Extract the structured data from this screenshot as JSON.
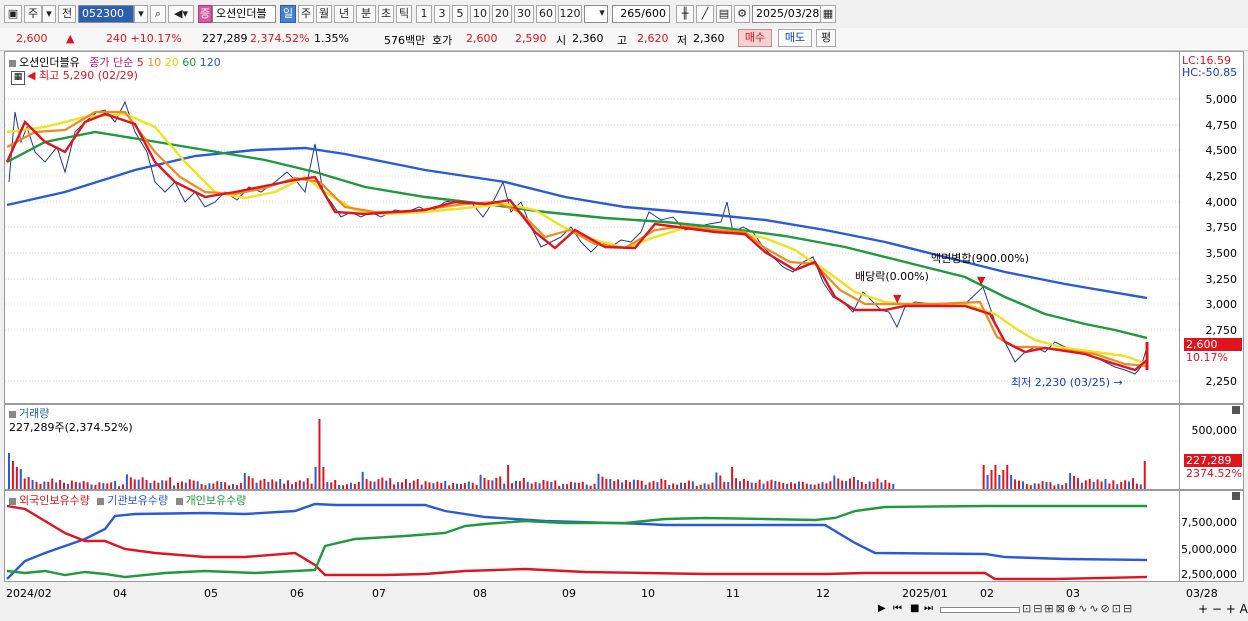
{
  "toolbar": {
    "period": "주",
    "prev_label": "전",
    "stock_code": "052300",
    "stock_name": "오션인더블",
    "period_buttons": [
      "일",
      "주",
      "월",
      "년",
      "분",
      "초",
      "틱"
    ],
    "interval_buttons": [
      "1",
      "3",
      "5",
      "10",
      "20",
      "30",
      "60",
      "120"
    ],
    "count": "265",
    "count_total": "/600",
    "date": "2025/03/28",
    "badge": "증"
  },
  "quote": {
    "price": "2,600",
    "change": "240 +10.17%",
    "volume": "227,289",
    "volume_ratio": "2,374.52%",
    "turnover": "1.35%",
    "amount": "576백만",
    "ask_label": "호가",
    "ask": "2,600",
    "bid": "2,590",
    "open_label": "시",
    "open": "2,360",
    "high_label": "고",
    "high": "2,620",
    "low_label": "저",
    "low": "2,360",
    "buy": "매수",
    "sell": "매도",
    "eval": "평"
  },
  "price_pane": {
    "title": "오션인더블유",
    "legend_prefix": "종가 단순",
    "ma_labels": [
      "5",
      "10",
      "20",
      "60",
      "120"
    ],
    "ma_colors": [
      "#e0141e",
      "#f08a1e",
      "#f0e21e",
      "#1e9a3c",
      "#2a5ad8"
    ],
    "high_note": "최고 5,290 (02/29)",
    "low_note": "최저 2,230 (03/25)",
    "dividend_note": "배당락(0.00%)",
    "split_note": "액면병합(900.00%)",
    "lc": "LC:16.59",
    "hc": "HC:-50.85",
    "yticks": [
      "5,000",
      "4,750",
      "4,500",
      "4,250",
      "4,000",
      "3,750",
      "3,500",
      "3,250",
      "3,000",
      "2,750",
      "2,250"
    ],
    "price_tag": "2,600",
    "pct_tag": "10.17%"
  },
  "volume_pane": {
    "title": "거래량",
    "subtitle": "227,289주(2,374.52%)",
    "ytick": "500,000",
    "vol_tag": "227,289",
    "pct_tag": "2374.52%"
  },
  "holding_pane": {
    "legend": [
      "외국인보유수량",
      "기관보유수량",
      "개인보유수량"
    ],
    "legend_colors": [
      "#e0141e",
      "#2a5ad8",
      "#1e9a3c"
    ],
    "yticks": [
      "7,500,000",
      "5,000,000",
      "2,500,000"
    ]
  },
  "xaxis": {
    "labels": [
      "2024/02",
      "04",
      "05",
      "06",
      "07",
      "08",
      "09",
      "10",
      "11",
      "12",
      "2025/01",
      "02",
      "03",
      "03/28"
    ]
  }
}
